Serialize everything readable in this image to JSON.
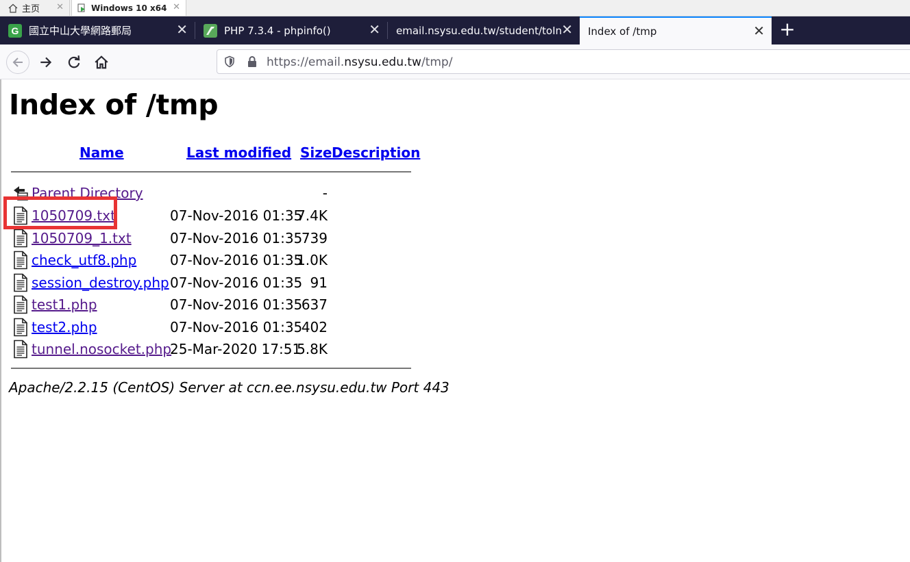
{
  "vm_tabs": [
    {
      "label": "主页",
      "icon": "home-icon"
    },
    {
      "label": "Windows 10 x64",
      "icon": "vm-icon"
    }
  ],
  "browser_tabs": [
    {
      "title": "國立中山大學網路郵局",
      "icon": "g-favicon",
      "color": "#3aa34a",
      "active": false
    },
    {
      "title": "PHP 7.3.4 - phpinfo()",
      "icon": "php-favicon",
      "color": "#58a85a",
      "active": false
    },
    {
      "title": "email.nsysu.edu.tw/student/toIn",
      "icon": "none",
      "active": false
    },
    {
      "title": "Index of /tmp",
      "icon": "none",
      "active": true
    }
  ],
  "url": {
    "prefix": "https://email.",
    "domain": "nsysu.edu.tw",
    "path": "/tmp/"
  },
  "page": {
    "title": "Index of /tmp",
    "columns": {
      "name": "Name",
      "last_modified": "Last modified",
      "size": "Size",
      "description": "Description"
    },
    "parent": {
      "name": "Parent Directory",
      "size": "-"
    },
    "files": [
      {
        "name": "1050709.txt",
        "modified": "07-Nov-2016 01:35",
        "size": "7.4K",
        "visited": true
      },
      {
        "name": "1050709_1.txt",
        "modified": "07-Nov-2016 01:35",
        "size": "739",
        "visited": true
      },
      {
        "name": "check_utf8.php",
        "modified": "07-Nov-2016 01:35",
        "size": "1.0K",
        "visited": false
      },
      {
        "name": "session_destroy.php",
        "modified": "07-Nov-2016 01:35",
        "size": "91",
        "visited": false
      },
      {
        "name": "test1.php",
        "modified": "07-Nov-2016 01:35",
        "size": "637",
        "visited": true
      },
      {
        "name": "test2.php",
        "modified": "07-Nov-2016 01:35",
        "size": "402",
        "visited": false
      },
      {
        "name": "tunnel.nosocket.php",
        "modified": "25-Mar-2020 17:51",
        "size": "5.8K",
        "visited": true
      }
    ],
    "footer": "Apache/2.2.15 (CentOS) Server at ccn.ee.nsysu.edu.tw Port 443"
  },
  "colors": {
    "tab_bar": "#1e1e3a",
    "link": "#0000ee",
    "visited_link": "#551a8b",
    "highlight": "#e83434"
  }
}
